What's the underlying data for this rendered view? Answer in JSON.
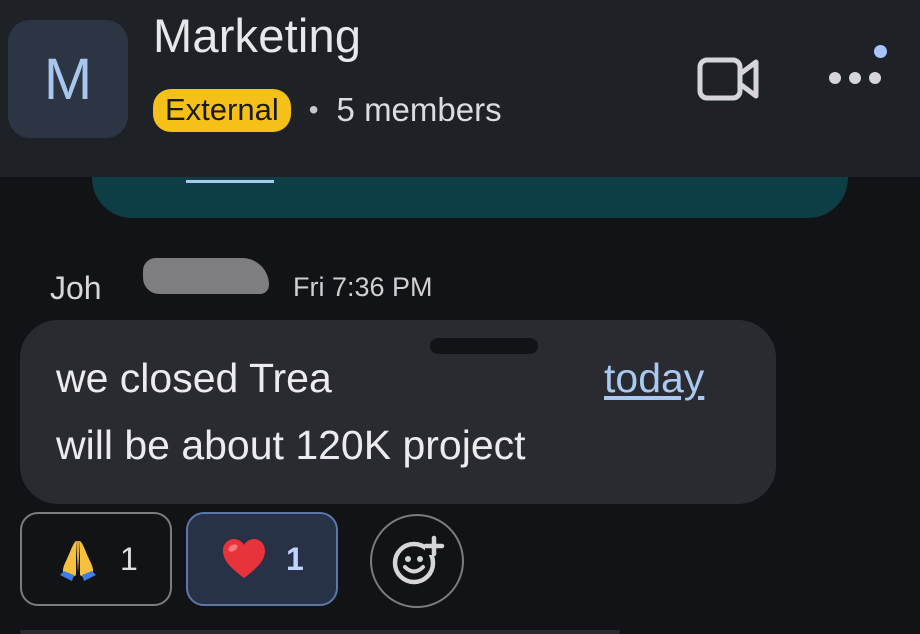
{
  "header": {
    "avatar_letter": "M",
    "title": "Marketing",
    "badge": "External",
    "separator": "•",
    "members": "5 members"
  },
  "message": {
    "sender": "Joh",
    "time": "Fri 7:36 PM",
    "line1_prefix": "we closed Trea",
    "link": "today",
    "line2": "will be about 120K project"
  },
  "reactions": [
    {
      "emoji": "folded-hands",
      "count": "1"
    },
    {
      "emoji": "red-heart",
      "count": "1"
    }
  ],
  "colors": {
    "background": "#121316",
    "header": "#1e2126",
    "badge": "#f5c118",
    "bubble": "#2a2b30",
    "link": "#a9c8f2",
    "accent": "#a7c4ff"
  }
}
